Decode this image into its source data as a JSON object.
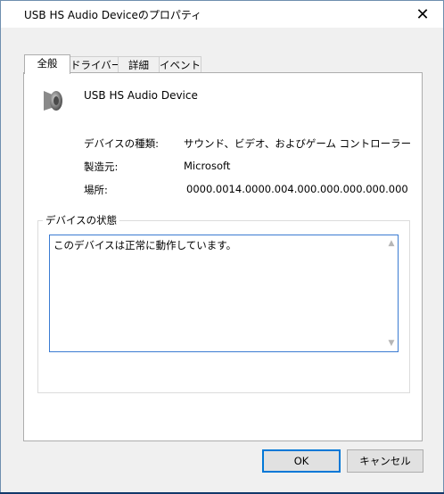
{
  "window": {
    "title": "USB HS Audio Deviceのプロパティ",
    "close_glyph": "✕"
  },
  "tabs": [
    {
      "label": "全般",
      "active": true
    },
    {
      "label": "ドライバー",
      "active": false
    },
    {
      "label": "詳細",
      "active": false
    },
    {
      "label": "イベント",
      "active": false
    }
  ],
  "device": {
    "name": "USB HS Audio Device",
    "icon": "speaker-icon",
    "properties": [
      {
        "label": "デバイスの種類:",
        "value": "サウンド、ビデオ、およびゲーム コントローラー"
      },
      {
        "label": "製造元:",
        "value": "Microsoft"
      },
      {
        "label": "場所:",
        "value": "0000.0014.0000.004.000.000.000.000.000"
      }
    ]
  },
  "status": {
    "legend": "デバイスの状態",
    "text": "このデバイスは正常に動作しています。",
    "scroll_up": "▲",
    "scroll_down": "▼"
  },
  "buttons": {
    "ok": "OK",
    "cancel": "キャンセル"
  },
  "colors": {
    "accent": "#0078d7",
    "desktop": "#1d4f86"
  }
}
